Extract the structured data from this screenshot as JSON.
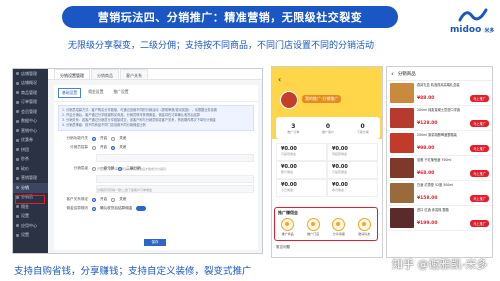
{
  "header": {
    "title": "营销玩法四、分销推广：精准营销，无限级社交裂变",
    "subtitle": "无限级分享裂变，二级分佣；支持按不同商品，不同门店设置不同的分销活动",
    "bottom_caption": "支持自购省钱，分享赚钱；支持自定义装修，裂变式推广",
    "watermark": "知乎 @谢雅凯-米多"
  },
  "logo": {
    "text": "midoo",
    "sub": "米多"
  },
  "admin": {
    "sidebar_items": [
      {
        "label": "店铺管理"
      },
      {
        "label": "店铺概况"
      },
      {
        "label": "商品管理"
      },
      {
        "label": "订单管理"
      },
      {
        "label": "会员管理"
      },
      {
        "label": "数据中心"
      },
      {
        "label": "营销中心"
      },
      {
        "label": "优惠券"
      },
      {
        "label": "拼团"
      },
      {
        "label": "秒杀"
      },
      {
        "label": "砍价"
      },
      {
        "label": "营销管理"
      },
      {
        "label": "分销"
      },
      {
        "label": "分销员"
      },
      {
        "label": "佣金"
      },
      {
        "label": "设置"
      },
      {
        "label": "应用中心"
      },
      {
        "label": "设置"
      }
    ],
    "tabs": [
      {
        "label": "分销设置管理"
      },
      {
        "label": "分销商品"
      },
      {
        "label": "客户关系"
      }
    ],
    "subtabs": [
      {
        "label": "基础设置"
      },
      {
        "label": "佣金设置"
      },
      {
        "label": "推广设置"
      }
    ],
    "notice_lines": [
      "1. 分销员招募方式：客户购买分享链接，可通过设置不同的分销活动（提现审核/邀请奖励），请根据业务设置",
      "2. 开启分销后，客户通过分享链接购买商品，分销员即可获得佣金，佣金将在订单确认收货后结算",
      "3. 分销关系：若客户通过分销员分享链接成交，该客户即与分销员绑定客户关系，有效期内再次下单仍计佣金",
      "4. 分销员等级：按不同商品不同门店设置不同分销佣金比例"
    ],
    "form": {
      "enable_label": "分销功能开关",
      "enable_on": "开启",
      "enable_off": "关闭",
      "recruit_label": "分销员招募",
      "recruit_opt1": "开启",
      "recruit_opt2": "关闭",
      "recruit_hint": "开启后，客户需要申请并审核通过后才能成为分销员",
      "level_label": "分销层级",
      "level_opt1": "一级分销",
      "level_opt2": "二级分销",
      "level_hint": "分销员可获得一级/二级下级客户订单佣金",
      "bind_label": "客户关系绑定",
      "bind_opt1": "开启",
      "bind_opt2": "关闭",
      "rule_label": "佣金结算规则",
      "rule_opt1": "确认收货后结算佣金",
      "save": "保存"
    }
  },
  "phone1": {
    "back": "‹",
    "name_tag": "我的推广·分销推广",
    "stats": [
      {
        "num": "3",
        "label": "推广订单"
      },
      {
        "num": "0",
        "label": "推广客户"
      },
      {
        "num": "0",
        "label": "下级分销"
      }
    ],
    "money": [
      {
        "value": "¥0.00",
        "label": "可提现佣金"
      },
      {
        "value": "¥0.00",
        "label": "待结算佣金"
      },
      {
        "value": "¥0.00",
        "label": "累计佣金"
      },
      {
        "value": "¥0.00",
        "label": "已提现佣金"
      },
      {
        "value": "¥0.00",
        "label": "今日佣金"
      },
      {
        "value": "¥0.00",
        "label": "本月佣金"
      }
    ],
    "tools_title": "推广赚佣金",
    "tools": [
      {
        "label": "推广商品"
      },
      {
        "label": "推广门店"
      },
      {
        "label": "分享海报"
      },
      {
        "label": "邀请好友"
      }
    ],
    "footer": "常见问题"
  },
  "phone2": {
    "title": "分销商品",
    "items": [
      {
        "name": "燕窝礼盒 精选燕窝高端礼盒装",
        "price": "¥88.00",
        "button": "马上推广",
        "color": "#c98a3e"
      },
      {
        "name": "200ml 纯麦芽威士忌进口洋酒",
        "price": "¥128.00",
        "button": "马上推广",
        "color": "#b73a2f"
      },
      {
        "name": "200ml 原浆精酿啤酒整箱装",
        "price": "¥98.00",
        "button": "马上推广",
        "color": "#c23a2a"
      },
      {
        "name": "尼雅 干红葡萄酒 750ml",
        "price": "¥68.00",
        "button": "马上推广",
        "color": "#7d3a2b"
      },
      {
        "name": "白酒 浓香型 52度 500ml",
        "price": "¥158.00",
        "button": "马上推广",
        "color": "#9a6a3c"
      },
      {
        "name": "进口 红酒 赤霞珠 整箱",
        "price": "¥199.00",
        "button": "马上推广",
        "color": "#5b2a2a"
      }
    ]
  }
}
